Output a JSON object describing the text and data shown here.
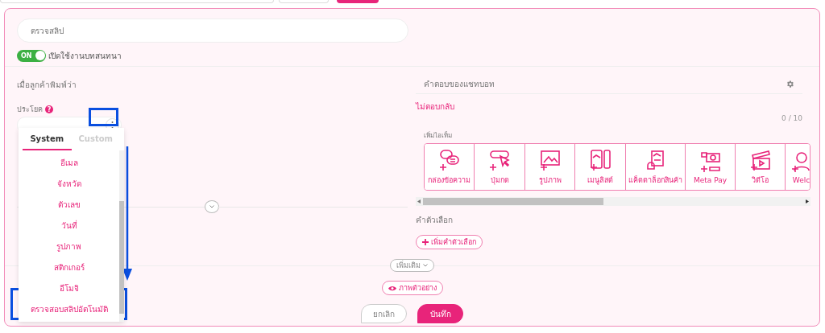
{
  "bot_name": {
    "value": "ตรวจสลิป"
  },
  "toggle": {
    "label": "ON",
    "on": true,
    "text": "เปิดใช้งานบทสนทนา"
  },
  "trigger": {
    "heading": "เมื่อลูกค้าพิมพ์ว่า",
    "label": "ประโยค",
    "help": "?"
  },
  "dropdown": {
    "tabs": [
      {
        "label": "System",
        "selected": true
      },
      {
        "label": "Custom",
        "selected": false
      }
    ],
    "items": [
      "อีเมล",
      "จังหวัด",
      "ตัวเลข",
      "วันที่",
      "รูปภาพ",
      "สติกเกอร์",
      "อีโมจิ",
      "ตรวจสอบสลิปอัตโนมัติ"
    ]
  },
  "response": {
    "heading": "คำตอบของแชทบอท",
    "reply_type": "ไม่ตอบกลับ",
    "counter": "0 / 10",
    "add_item_label": "เพิ่มไอเท็ม",
    "items": [
      {
        "label": "กล่องข้อความ"
      },
      {
        "label": "ปุ่มกด"
      },
      {
        "label": "รูปภาพ"
      },
      {
        "label": "เมนูลิสต์"
      },
      {
        "label": "แค็ตตาล็อกสินค้า"
      },
      {
        "label": "Meta Pay"
      },
      {
        "label": "วิดีโอ"
      },
      {
        "label": "Welc"
      }
    ],
    "options_label": "คำตัวเลือก",
    "add_option": "เพิ่มคำตัวเลือก"
  },
  "more": "เพิ่มเติม",
  "preview": "ภาพตัวอย่าง",
  "buttons": {
    "cancel": "ยกเลิก",
    "save": "บันทึก"
  }
}
